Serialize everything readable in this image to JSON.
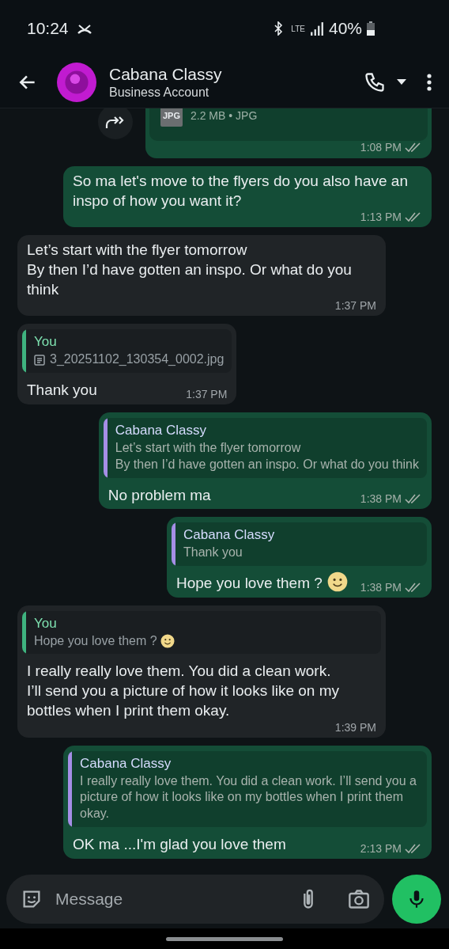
{
  "status_bar": {
    "time": "10:24",
    "network": "LTE",
    "battery": "40%"
  },
  "header": {
    "name": "Cabana Classy",
    "subtitle": "Business Account"
  },
  "messages": [
    {
      "kind": "file",
      "outgoing": true,
      "file_type": "JPG",
      "file_meta": "2.2 MB • JPG",
      "time": "1:08 PM",
      "read": true
    },
    {
      "kind": "text",
      "outgoing": true,
      "text": "So ma let's move to the flyers do you also have an inspo of how you want it?",
      "time": "1:13 PM",
      "read": true
    },
    {
      "kind": "text",
      "outgoing": false,
      "text": "Let’s start with the flyer tomorrow\nBy then I’d have gotten an inspo. Or what do you think",
      "time": "1:37 PM"
    },
    {
      "kind": "text",
      "outgoing": false,
      "quote": {
        "author": "You",
        "kind": "file",
        "text": "3_20251102_130354_0002.jpg",
        "color": "#3fb37f"
      },
      "text": "Thank you",
      "time": "1:37 PM"
    },
    {
      "kind": "text",
      "outgoing": true,
      "quote": {
        "author": "Cabana Classy",
        "kind": "text",
        "text": "Let’s start with the flyer tomorrow\nBy then I’d have gotten an inspo. Or what do you think",
        "color": "#a58ee6"
      },
      "text": "No problem ma",
      "time": "1:38 PM",
      "read": true
    },
    {
      "kind": "text",
      "outgoing": true,
      "quote": {
        "author": "Cabana Classy",
        "kind": "text",
        "text": "Thank you",
        "color": "#a58ee6"
      },
      "text": "Hope you love them ?",
      "emoji": true,
      "time": "1:38 PM",
      "read": true
    },
    {
      "kind": "text",
      "outgoing": false,
      "quote": {
        "author": "You",
        "kind": "text",
        "text": "Hope you love them ?",
        "emoji": true,
        "color": "#3fb37f"
      },
      "text": "I really really love them. You did a clean work.\nI’ll send you a picture of how it looks like on my bottles when I print them okay.",
      "time": "1:39 PM"
    },
    {
      "kind": "text",
      "outgoing": true,
      "quote": {
        "author": "Cabana Classy",
        "kind": "text",
        "text": "I really really love them. You did a clean work. I’ll send you a picture of how it looks like on my bottles when I print them okay.",
        "color": "#a58ee6"
      },
      "text": "OK ma ...I'm glad you love them",
      "time": "2:13 PM",
      "read": true
    }
  ],
  "composer": {
    "placeholder": "Message"
  }
}
